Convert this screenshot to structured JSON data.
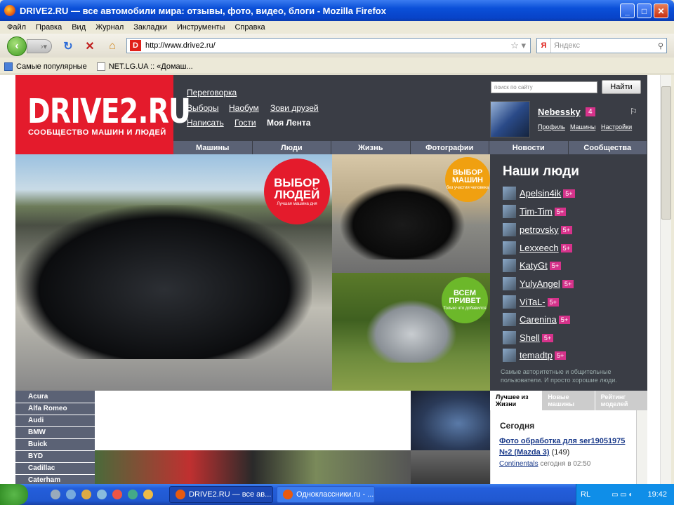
{
  "window": {
    "title": "DRIVE2.RU — все автомобили мира: отзывы, фото, видео, блоги - Mozilla Firefox"
  },
  "menu": [
    "Файл",
    "Правка",
    "Вид",
    "Журнал",
    "Закладки",
    "Инструменты",
    "Справка"
  ],
  "address": {
    "url": "http://www.drive2.ru/",
    "search_placeholder": "Яндекс"
  },
  "bookmarks": [
    "Самые популярные",
    "NET.LG.UA :: «Домаш..."
  ],
  "site": {
    "logo": "DRIVE2.RU",
    "tagline": "СООБЩЕСТВО МАШИН И ЛЮДЕЙ",
    "links": [
      "Переговорка",
      "Выборы",
      "Наобум",
      "Зови друзей",
      "Написать",
      "Гости",
      "Моя Лента"
    ],
    "search_placeholder": "поиск по сайту",
    "search_button": "Найти",
    "user": {
      "name": "Nebessky",
      "count": "4",
      "links": [
        "Профиль",
        "Машины",
        "Настройки"
      ]
    },
    "tabs": [
      "Машины",
      "Люди",
      "Жизнь",
      "Фотографии",
      "Новости",
      "Сообщества"
    ],
    "stickers": [
      {
        "title": "ВЫБОР ЛЮДЕЙ",
        "sub": "Лучшая машина дня"
      },
      {
        "title": "ВЫБОР МАШИН",
        "sub": "без участия человека"
      },
      {
        "title": "ВСЕМ ПРИВЕТ",
        "sub": "Только что добавился"
      }
    ],
    "people_title": "Наши люди",
    "people": [
      {
        "name": "Apelsin4ik",
        "badge": "5+"
      },
      {
        "name": "Tim-Tim",
        "badge": "5+"
      },
      {
        "name": "petrovsky",
        "badge": "5+"
      },
      {
        "name": "Lexxeech",
        "badge": "5+"
      },
      {
        "name": "KatyGt",
        "badge": "5+"
      },
      {
        "name": "YulyAngel",
        "badge": "5+"
      },
      {
        "name": "ViTaL-",
        "badge": "5+"
      },
      {
        "name": "Carenina",
        "badge": "5+"
      },
      {
        "name": "Shell",
        "badge": "5+"
      },
      {
        "name": "temadtp",
        "badge": "5+"
      }
    ],
    "people_note": "Самые авторитетные и общительные пользователи. И просто хорошие люди.",
    "brands": [
      "Acura",
      "Alfa Romeo",
      "Audi",
      "BMW",
      "Buick",
      "BYD",
      "Cadillac",
      "Caterham"
    ],
    "best_tabs": [
      "Лучшее из Жизни",
      "Новые машины",
      "Рейтинг моделей"
    ],
    "today": "Сегодня",
    "best": {
      "title": "Фото обработка для ser19051975 №2 (Mazda 3)",
      "count": "(149)",
      "author": "Continentals",
      "time": "сегодня в 02:50"
    }
  },
  "taskbar": {
    "tasks": [
      "DRIVE2.RU — все ав...",
      "Одноклассники.ru - ..."
    ],
    "lang": "RL",
    "clock": "19:42"
  },
  "colors": {
    "brand_red": "#e41b2c",
    "badge_pink": "#d6338b",
    "dark": "#3a3d45"
  }
}
